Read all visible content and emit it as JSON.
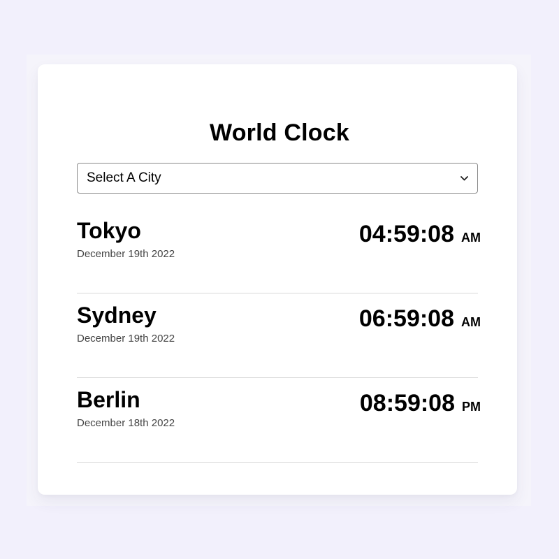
{
  "app": {
    "title": "World Clock"
  },
  "city_select": {
    "selected": "Select A City"
  },
  "cities": [
    {
      "name": "Tokyo",
      "date": "December 19th 2022",
      "time": "04:59:08",
      "period": "AM"
    },
    {
      "name": "Sydney",
      "date": "December 19th 2022",
      "time": "06:59:08",
      "period": "AM"
    },
    {
      "name": "Berlin",
      "date": "December 18th 2022",
      "time": "08:59:08",
      "period": "PM"
    }
  ],
  "icons": {
    "select_arrow": "chevron-down-icon"
  },
  "colors": {
    "page_background": "#f2f0fc",
    "card_background": "#ffffff",
    "divider": "#d9d9d9",
    "date_text": "#444444"
  }
}
